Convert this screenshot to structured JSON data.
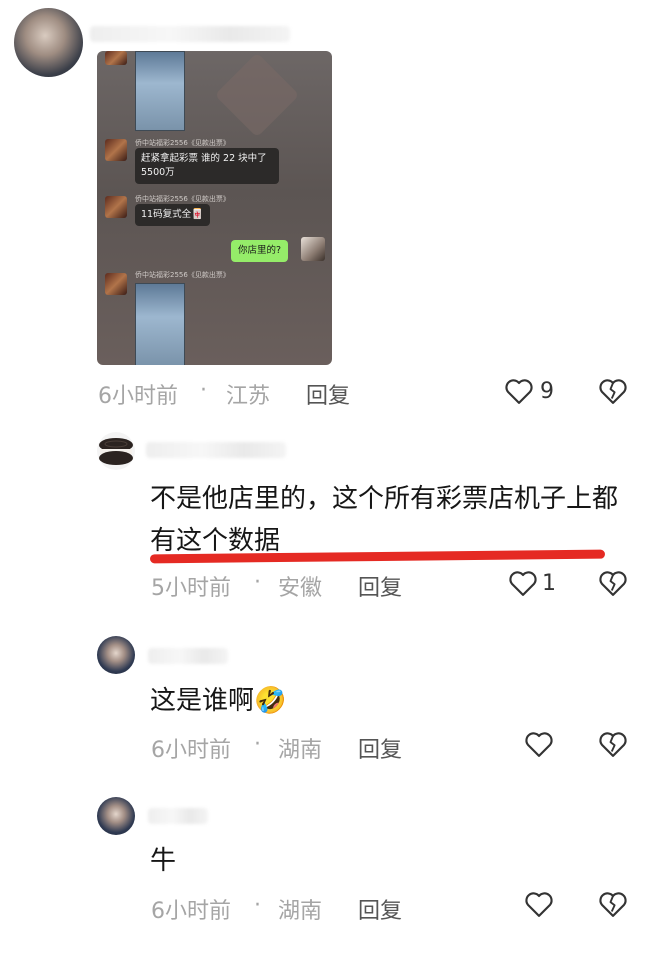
{
  "post": {
    "embedded_chat": {
      "sender_name": "侨中站福彩2556《见款出票》",
      "message_1": "赶紧拿起彩票 谁的 22 块中了 5500万",
      "message_2": "11码复式全",
      "message_2_emoji": "🀄",
      "my_message": "你店里的?"
    },
    "time": "6小时前",
    "sep": "·",
    "location": "江苏",
    "reply_label": "回复",
    "likes": "9"
  },
  "comments": [
    {
      "text": "不是他店里的，这个所有彩票店机子上都有这个数据",
      "time": "5小时前",
      "sep": "·",
      "location": "安徽",
      "reply_label": "回复",
      "likes": "1"
    },
    {
      "text": "这是谁啊",
      "emoji": "🤣",
      "time": "6小时前",
      "sep": "·",
      "location": "湖南",
      "reply_label": "回复",
      "likes": ""
    },
    {
      "text": "牛",
      "time": "6小时前",
      "sep": "·",
      "location": "湖南",
      "reply_label": "回复",
      "likes": ""
    }
  ],
  "colors": {
    "highlight_underline": "#e52a23",
    "meta_gray": "#a5a5a5",
    "wechat_green": "#95ec69"
  },
  "icons": [
    "heart-outline-icon",
    "broken-heart-icon"
  ]
}
